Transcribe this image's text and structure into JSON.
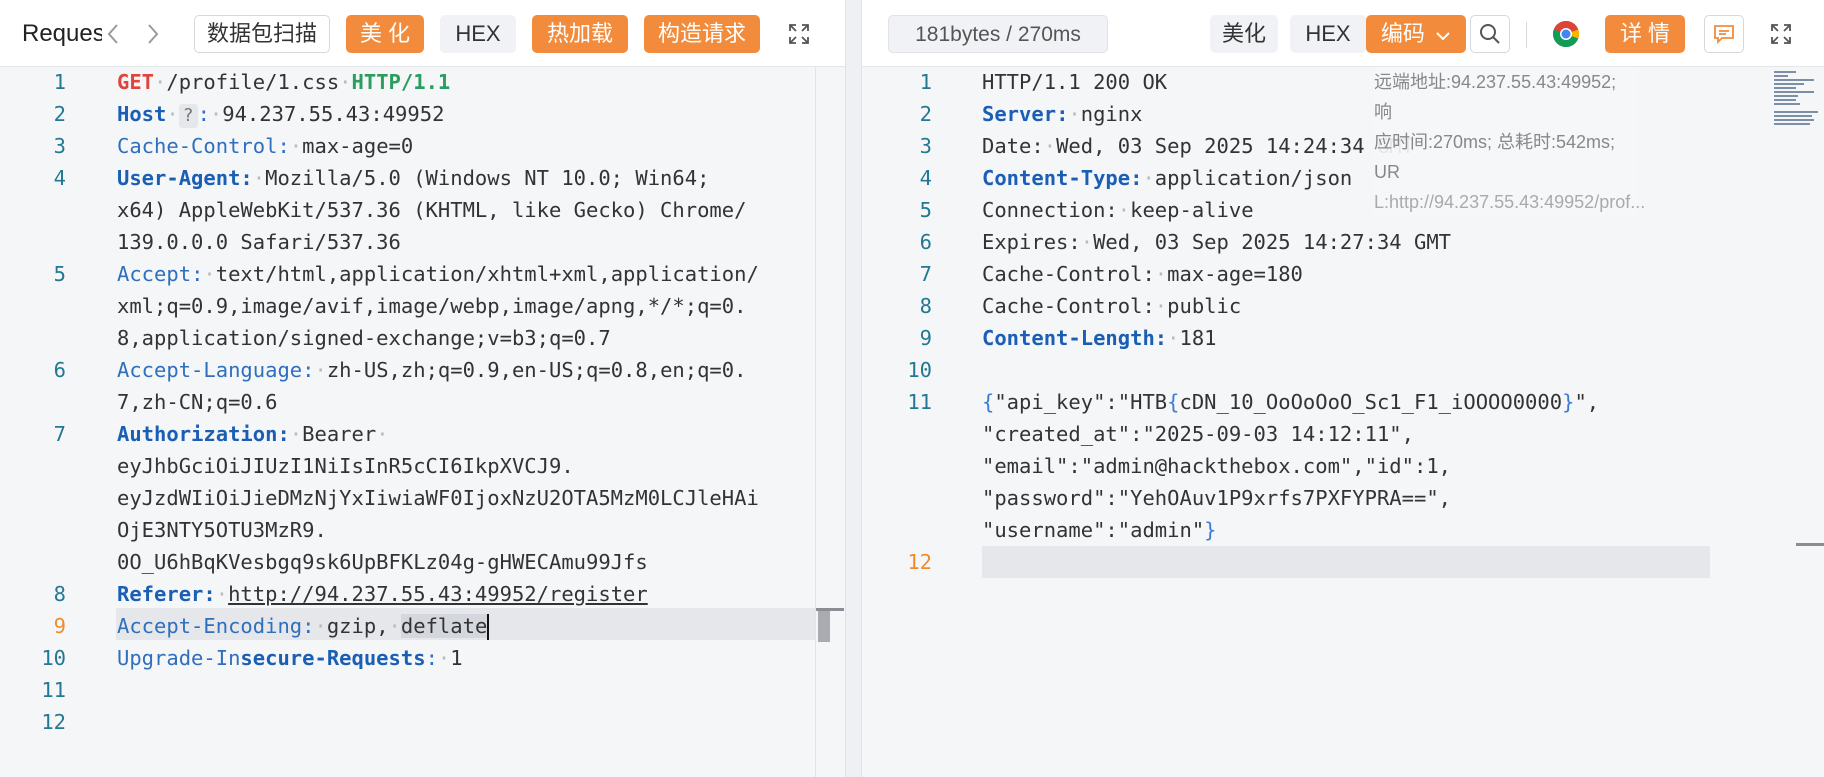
{
  "left": {
    "tab_title": "Reques",
    "buttons": {
      "scan": "数据包扫描",
      "beautify": "美 化",
      "hex": "HEX",
      "hotload": "热加载",
      "construct": "构造请求"
    }
  },
  "right": {
    "stats": "181bytes / 270ms",
    "buttons": {
      "beautify": "美化",
      "hex": "HEX",
      "encode": "编码",
      "details": "详 情"
    },
    "info": [
      "远端地址:94.237.55.43:49952; 响",
      "应时间:270ms; 总耗时:542ms; UR",
      "L:http://94.237.55.43:49952/prof..."
    ]
  },
  "request_lines": {
    "l1": {
      "num": "1",
      "method": "GET",
      "path": "/profile/1.css",
      "version": "HTTP/1.1"
    },
    "l2": {
      "num": "2",
      "key": "Host",
      "help": "?",
      "value": "94.237.55.43:49952"
    },
    "l3": {
      "num": "3",
      "key": "Cache-Control",
      "value": "max-age=0"
    },
    "l4": {
      "num": "4",
      "key": "User-Agent",
      "v1": "Mozilla/5.0 (Windows NT 10.0; Win64;",
      "v2": "x64) AppleWebKit/537.36 (KHTML, like Gecko) Chrome/",
      "v3": "139.0.0.0 Safari/537.36"
    },
    "l5": {
      "num": "5",
      "key": "Accept",
      "v1": "text/html,application/xhtml+xml,application/",
      "v2": "xml;q=0.9,image/avif,image/webp,image/apng,*/*;q=0.",
      "v3": "8,application/signed-exchange;v=b3;q=0.7"
    },
    "l6": {
      "num": "6",
      "key": "Accept-Language",
      "v1": "zh-US,zh;q=0.9,en-US;q=0.8,en;q=0.",
      "v2": "7,zh-CN;q=0.6"
    },
    "l7": {
      "num": "7",
      "key": "Authorization",
      "v1": "Bearer",
      "v2": "eyJhbGciOiJIUzI1NiIsInR5cCI6IkpXVCJ9.",
      "v3": "eyJzdWIiOiJieDMzNjYxIiwiaWF0IjoxNzU2OTA5MzM0LCJleHAi",
      "v4": "OjE3NTY5OTU3MzR9.",
      "v5": "0O_U6hBqKVesbgq9sk6UpBFKLz04g-gHWECAmu99Jfs"
    },
    "l8": {
      "num": "8",
      "key": "Referer",
      "value": "http://94.237.55.43:49952/register"
    },
    "l9": {
      "num": "9",
      "key": "Accept-Encoding",
      "v1": "gzip,",
      "v2": "deflate"
    },
    "l10": {
      "num": "10",
      "key_a": "Upgrade-In",
      "key_b": "secure-Requests",
      "value": "1"
    },
    "l11": {
      "num": "11"
    },
    "l12": {
      "num": "12"
    }
  },
  "response_lines": {
    "l1": {
      "num": "1",
      "text": "HTTP/1.1 200 OK"
    },
    "l2": {
      "num": "2",
      "key": "Server",
      "value": "nginx"
    },
    "l3": {
      "num": "3",
      "key": "Date",
      "value": "Wed, 03 Sep 2025 14:24:34 GMT"
    },
    "l4": {
      "num": "4",
      "key": "Content-Type",
      "value": "application/json"
    },
    "l5": {
      "num": "5",
      "key": "Connection",
      "value": "keep-alive"
    },
    "l6": {
      "num": "6",
      "key": "Expires",
      "value": "Wed, 03 Sep 2025 14:27:34 GMT"
    },
    "l7": {
      "num": "7",
      "key": "Cache-Control",
      "value": "max-age=180"
    },
    "l8": {
      "num": "8",
      "key": "Cache-Control",
      "value": "public"
    },
    "l9": {
      "num": "9",
      "key": "Content-Length",
      "value": "181"
    },
    "l10": {
      "num": "10"
    },
    "l11": {
      "num": "11",
      "open": "{",
      "a": "\"api_key\":\"HTB",
      "b": "{",
      "c": "cDN_10_OoOoOoO_Sc1_F1_iOOOO0000",
      "d": "}",
      "e": "\",",
      "f": "\"created_at\":\"2025-09-03 14:12:11\",",
      "g": "\"email\":\"admin@hackthebox.com\",\"id\":1,",
      "h": "\"password\":\"YehOAuv1P9xrfs7PXFYPRA==\",",
      "i": "\"username\":\"admin\"",
      "close": "}"
    },
    "l12": {
      "num": "12"
    }
  },
  "icons": {
    "back": "chevron-left-icon",
    "forward": "chevron-right-icon",
    "expand": "expand-icon",
    "search": "search-icon",
    "chrome": "chrome-icon",
    "comment": "comment-icon",
    "dropdown": "chevron-down-icon"
  },
  "colors": {
    "accent": "#f28c3c",
    "header_key": "#1b5fb5",
    "method": "#e0453d",
    "version": "#2a9d5f",
    "line_number": "#237893"
  }
}
